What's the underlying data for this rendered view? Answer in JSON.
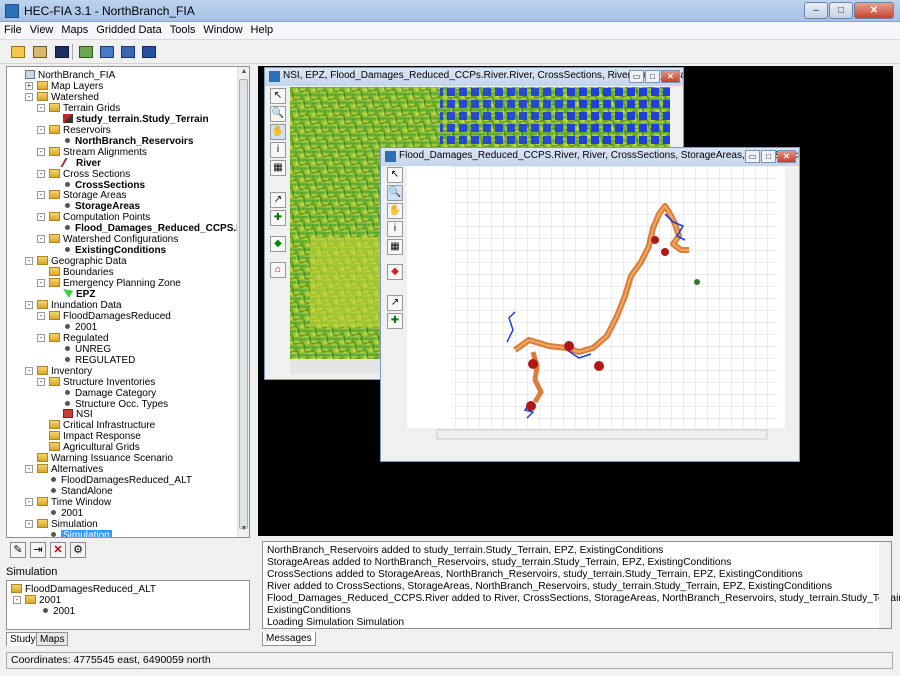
{
  "window": {
    "title": "HEC-FIA 3.1 - NorthBranch_FIA",
    "minimize": "–",
    "maximize": "□",
    "close": "✕"
  },
  "menu": [
    "File",
    "View",
    "Maps",
    "Gridded Data",
    "Tools",
    "Window",
    "Help"
  ],
  "toolbar_icons": [
    "open-folder-icon",
    "open-study-icon",
    "save-icon",
    "map-layers-icon",
    "refresh-icon",
    "tile-windows-icon",
    "cascade-windows-icon"
  ],
  "tree": [
    {
      "label": "NorthBranch_FIA",
      "level": 0,
      "icon": "study"
    },
    {
      "label": "Map Layers",
      "level": 1,
      "icon": "folder",
      "pm": "+"
    },
    {
      "label": "Watershed",
      "level": 1,
      "icon": "folder",
      "pm": "-"
    },
    {
      "label": "Terrain Grids",
      "level": 2,
      "icon": "folder",
      "pm": "-"
    },
    {
      "label": "study_terrain.Study_Terrain",
      "level": 3,
      "icon": "terrain",
      "bold": true
    },
    {
      "label": "Reservoirs",
      "level": 2,
      "icon": "folder",
      "pm": "-"
    },
    {
      "label": "NorthBranch_Reservoirs",
      "level": 3,
      "icon": "bullet",
      "bold": true
    },
    {
      "label": "Stream Alignments",
      "level": 2,
      "icon": "folder",
      "pm": "-"
    },
    {
      "label": "River",
      "level": 3,
      "icon": "river",
      "bold": true
    },
    {
      "label": "Cross Sections",
      "level": 2,
      "icon": "folder",
      "pm": "-"
    },
    {
      "label": "CrossSections",
      "level": 3,
      "icon": "bullet",
      "bold": true
    },
    {
      "label": "Storage Areas",
      "level": 2,
      "icon": "folder",
      "pm": "-"
    },
    {
      "label": "StorageAreas",
      "level": 3,
      "icon": "bullet",
      "bold": true
    },
    {
      "label": "Computation Points",
      "level": 2,
      "icon": "folder",
      "pm": "-"
    },
    {
      "label": "Flood_Damages_Reduced_CCPS.River",
      "level": 3,
      "icon": "bullet",
      "bold": true
    },
    {
      "label": "Watershed Configurations",
      "level": 2,
      "icon": "folder",
      "pm": "-"
    },
    {
      "label": "ExistingConditions",
      "level": 3,
      "icon": "bullet",
      "bold": true
    },
    {
      "label": "Geographic Data",
      "level": 1,
      "icon": "folder",
      "pm": "-"
    },
    {
      "label": "Boundaries",
      "level": 2,
      "icon": "folder"
    },
    {
      "label": "Emergency Planning Zone",
      "level": 2,
      "icon": "folder",
      "pm": "-"
    },
    {
      "label": "EPZ",
      "level": 3,
      "icon": "epz",
      "bold": true
    },
    {
      "label": "Inundation Data",
      "level": 1,
      "icon": "folder",
      "pm": "-"
    },
    {
      "label": "FloodDamagesReduced",
      "level": 2,
      "icon": "folder",
      "pm": "-"
    },
    {
      "label": "2001",
      "level": 3,
      "icon": "bullet"
    },
    {
      "label": "Regulated",
      "level": 2,
      "icon": "folder",
      "pm": "-"
    },
    {
      "label": "UNREG",
      "level": 3,
      "icon": "bullet"
    },
    {
      "label": "REGULATED",
      "level": 3,
      "icon": "bullet"
    },
    {
      "label": "Inventory",
      "level": 1,
      "icon": "folder",
      "pm": "-"
    },
    {
      "label": "Structure Inventories",
      "level": 2,
      "icon": "folder",
      "pm": "-"
    },
    {
      "label": "Damage Category",
      "level": 3,
      "icon": "bullet"
    },
    {
      "label": "Structure Occ. Types",
      "level": 3,
      "icon": "bullet"
    },
    {
      "label": "NSI",
      "level": 3,
      "icon": "nsi"
    },
    {
      "label": "Critical Infrastructure",
      "level": 2,
      "icon": "folder"
    },
    {
      "label": "Impact Response",
      "level": 2,
      "icon": "folder"
    },
    {
      "label": "Agricultural Grids",
      "level": 2,
      "icon": "folder"
    },
    {
      "label": "Warning Issuance Scenario",
      "level": 1,
      "icon": "folder"
    },
    {
      "label": "Alternatives",
      "level": 1,
      "icon": "folder",
      "pm": "-"
    },
    {
      "label": "FloodDamagesReduced_ALT",
      "level": 2,
      "icon": "bullet"
    },
    {
      "label": "StandAlone",
      "level": 2,
      "icon": "bullet"
    },
    {
      "label": "Time Window",
      "level": 1,
      "icon": "folder",
      "pm": "-"
    },
    {
      "label": "2001",
      "level": 2,
      "icon": "bullet"
    },
    {
      "label": "Simulation",
      "level": 1,
      "icon": "folder",
      "pm": "-"
    },
    {
      "label": "Simulation",
      "level": 2,
      "icon": "bullet",
      "selected": true
    }
  ],
  "lower_tools": [
    "edit",
    "move",
    "delete",
    "run"
  ],
  "simulation": {
    "header": "Simulation",
    "items": [
      {
        "label": "FloodDamagesReduced_ALT",
        "level": 0,
        "icon": "folder"
      },
      {
        "label": "2001",
        "level": 1,
        "icon": "folder"
      },
      {
        "label": "2001",
        "level": 2,
        "icon": "bullet"
      }
    ]
  },
  "left_tabs": [
    "Study",
    "Maps"
  ],
  "map_window_1": {
    "title": "NSI, EPZ, Flood_Damages_Reduced_CCPs.River.River, CrossSections, River, study_terrain.Study_Terr..."
  },
  "map_window_2": {
    "title": "Flood_Damages_Reduced_CCPS.River, River, CrossSections, StorageAreas, NorthBranch_Reservoirs, ..."
  },
  "messages": [
    "NorthBranch_Reservoirs added to study_terrain.Study_Terrain, EPZ, ExistingConditions",
    "StorageAreas added to NorthBranch_Reservoirs, study_terrain.Study_Terrain, EPZ, ExistingConditions",
    "CrossSections added to StorageAreas, NorthBranch_Reservoirs, study_terrain.Study_Terrain, EPZ, ExistingConditions",
    "River added to CrossSections, StorageAreas, NorthBranch_Reservoirs, study_terrain.Study_Terrain, EPZ, ExistingConditions",
    "Flood_Damages_Reduced_CCPS.River added to River, CrossSections, StorageAreas, NorthBranch_Reservoirs, study_terrain.Study_Terrain, EPZ,",
    "ExistingConditions",
    "Loading Simulation Simulation"
  ],
  "messages_tab": "Messages",
  "status": "Coordinates: 4775545 east, 6490059 north",
  "colors": {
    "selection": "#3399ff",
    "desktop": "#000000",
    "river_orange": "#e8822a",
    "node_red": "#b01818",
    "channel_blue": "#1f3fd6"
  }
}
